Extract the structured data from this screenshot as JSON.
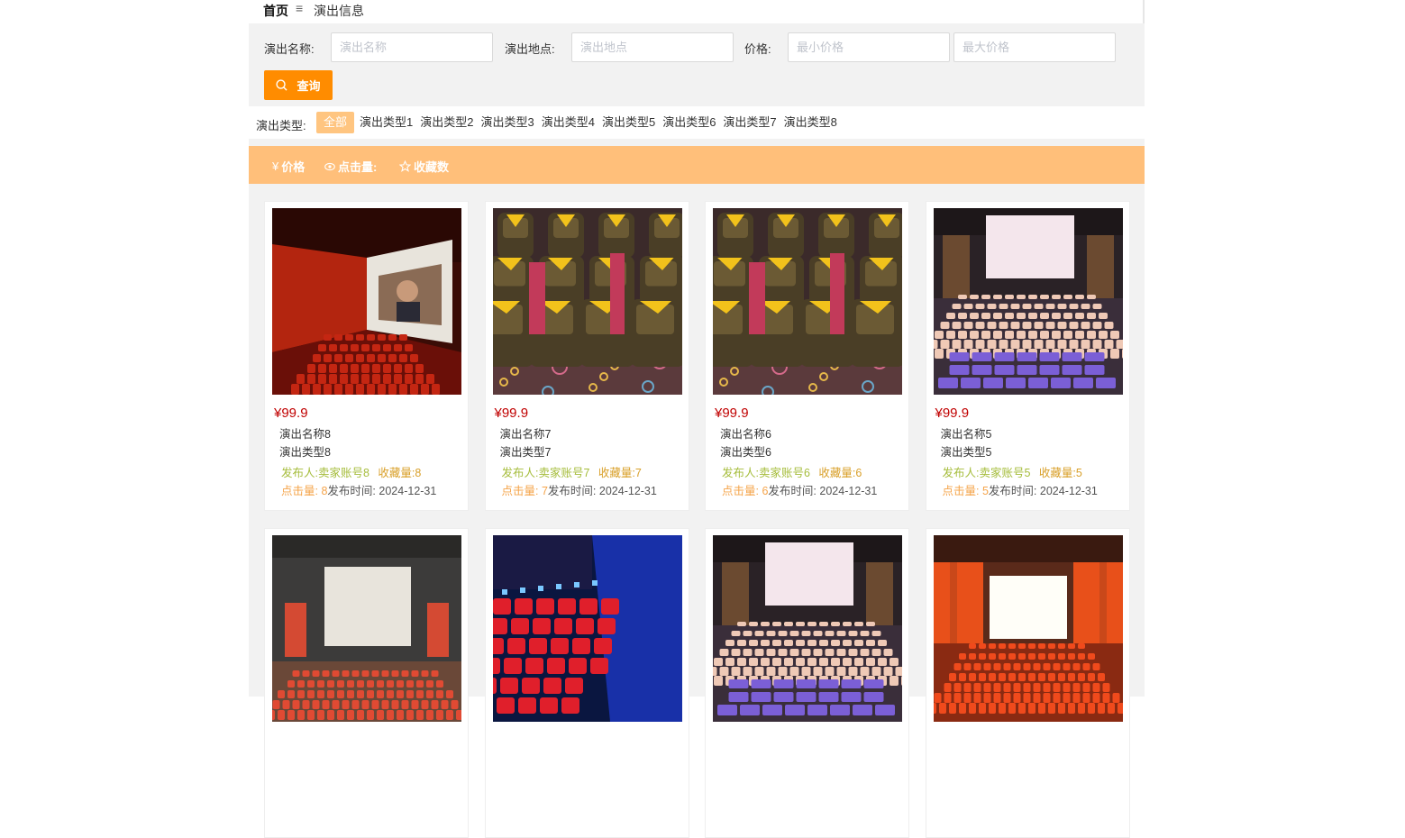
{
  "breadcrumb": {
    "home": "首页",
    "separator": "≡",
    "current": "演出信息"
  },
  "search": {
    "name_label": "演出名称:",
    "name_placeholder": "演出名称",
    "place_label": "演出地点:",
    "place_placeholder": "演出地点",
    "price_label": "价格:",
    "min_placeholder": "最小价格",
    "max_placeholder": "最大价格",
    "query_label": "查询"
  },
  "types": {
    "label": "演出类型:",
    "items": [
      "全部",
      "演出类型1",
      "演出类型2",
      "演出类型3",
      "演出类型4",
      "演出类型5",
      "演出类型6",
      "演出类型7",
      "演出类型8"
    ],
    "active": "全部"
  },
  "sort": {
    "price": "价格",
    "clicks": "点击量:",
    "favorites": "收藏数"
  },
  "labels": {
    "publisher": "发布人:",
    "fav_count": "收藏量:",
    "click_count": "点击量:",
    "publish_time": "发布时间:"
  },
  "cards": [
    {
      "price": "¥99.9",
      "name": "演出名称8",
      "type": "演出类型8",
      "publisher": "卖家账号8",
      "favs": "8",
      "clicks": "8",
      "time": "2024-12-31",
      "image": "cinema-red-hall"
    },
    {
      "price": "¥99.9",
      "name": "演出名称7",
      "type": "演出类型7",
      "publisher": "卖家账号7",
      "favs": "7",
      "clicks": "7",
      "time": "2024-12-31",
      "image": "vip-recliner-seats"
    },
    {
      "price": "¥99.9",
      "name": "演出名称6",
      "type": "演出类型6",
      "publisher": "卖家账号6",
      "favs": "6",
      "clicks": "6",
      "time": "2024-12-31",
      "image": "vip-recliner-seats"
    },
    {
      "price": "¥99.9",
      "name": "演出名称5",
      "type": "演出类型5",
      "publisher": "卖家账号5",
      "favs": "5",
      "clicks": "5",
      "time": "2024-12-31",
      "image": "cinema-purple-seats"
    },
    {
      "image": "cinema-grey-hall"
    },
    {
      "image": "cinema-blue-red"
    },
    {
      "image": "cinema-purple-seats"
    },
    {
      "image": "cinema-orange-hall"
    }
  ],
  "colors": {
    "accent": "#ff8c00",
    "sortbar": "#ffbf7a",
    "active_tab": "#ffc580",
    "price": "#c00000",
    "publisher": "#a6bd3c",
    "favorites": "#d9a02a",
    "clicks": "#f5a44a"
  }
}
